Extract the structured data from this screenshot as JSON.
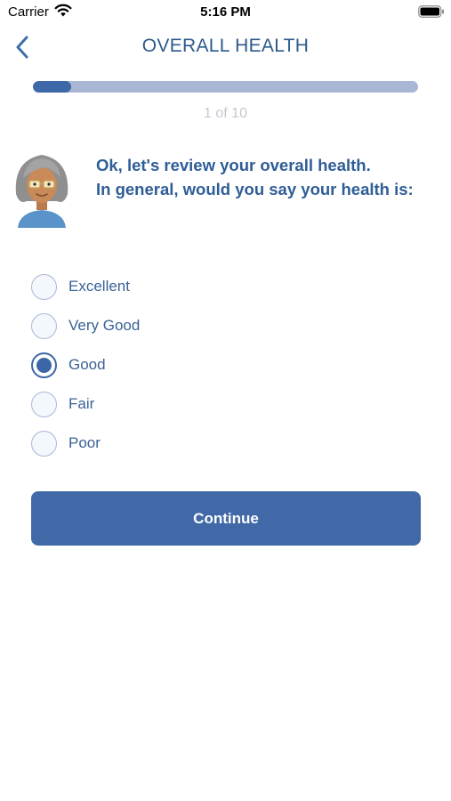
{
  "status_bar": {
    "carrier": "Carrier",
    "time": "5:16 PM"
  },
  "header": {
    "title": "OVERALL HEALTH",
    "back_icon": "chevron-left-icon"
  },
  "progress": {
    "text": "1 of 10",
    "current": 1,
    "total": 10
  },
  "question": {
    "line1": "Ok, let's review your overall health.",
    "line2": "In general, would you say your health is:"
  },
  "options": [
    {
      "label": "Excellent",
      "selected": false
    },
    {
      "label": "Very Good",
      "selected": false
    },
    {
      "label": "Good",
      "selected": true
    },
    {
      "label": "Fair",
      "selected": false
    },
    {
      "label": "Poor",
      "selected": false
    }
  ],
  "continue_label": "Continue",
  "colors": {
    "primary": "#4169a8",
    "title": "#2d5a8c",
    "progress_track": "#aab7d4",
    "progress_fill": "#3f68a8",
    "muted_text": "#c3c7cf"
  }
}
